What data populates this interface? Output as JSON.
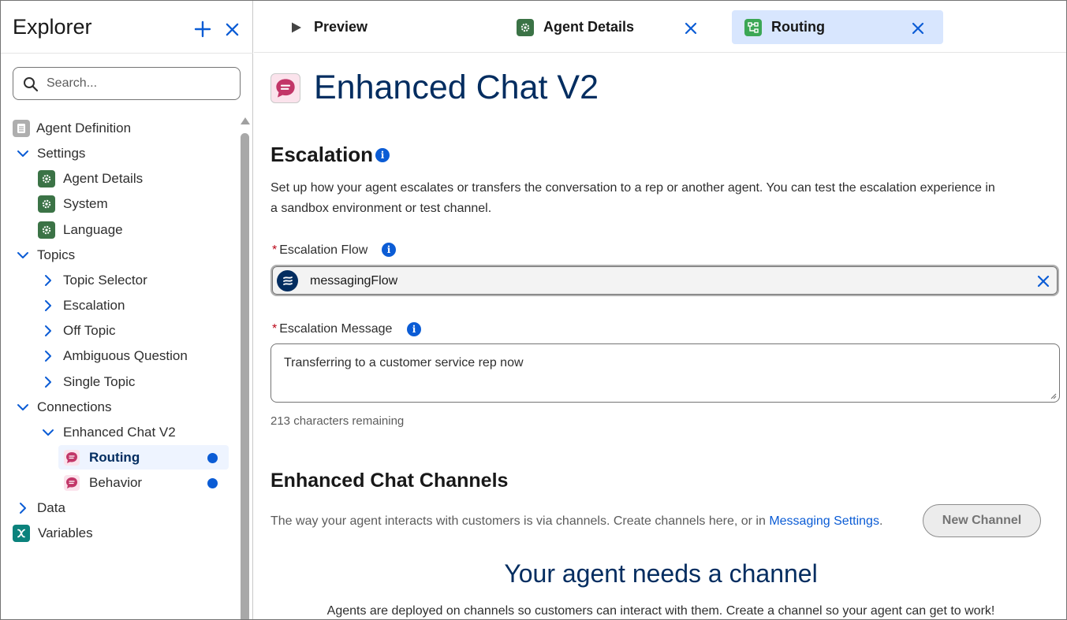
{
  "sidebar": {
    "title": "Explorer",
    "search_placeholder": "Search...",
    "tree": {
      "agent_definition": "Agent Definition",
      "settings": "Settings",
      "agent_details": "Agent Details",
      "system": "System",
      "language": "Language",
      "topics": "Topics",
      "topic_selector": "Topic Selector",
      "escalation": "Escalation",
      "off_topic": "Off Topic",
      "ambiguous_question": "Ambiguous Question",
      "single_topic": "Single Topic",
      "connections": "Connections",
      "enhanced_chat_v2": "Enhanced Chat V2",
      "routing": "Routing",
      "behavior": "Behavior",
      "data": "Data",
      "variables": "Variables"
    }
  },
  "tabs": {
    "preview": "Preview",
    "agent_details": "Agent Details",
    "routing": "Routing"
  },
  "main": {
    "title": "Enhanced Chat V2",
    "escalation": {
      "heading": "Escalation",
      "description_line1": "Set up how your agent escalates or transfers the conversation to a rep or another agent. You can test the escalation experience in",
      "description_line2": "a sandbox environment or test channel.",
      "flow_label": "Escalation Flow",
      "flow_value": "messagingFlow",
      "message_label": "Escalation Message",
      "message_value": "Transferring to a customer service rep now",
      "chars_remaining": "213 characters remaining"
    },
    "channels": {
      "heading": "Enhanced Chat Channels",
      "description": "The way your agent interacts with customers is via channels. Create channels here, or in ",
      "link": "Messaging Settings",
      "period": ".",
      "new_button": "New Channel",
      "empty_title": "Your agent needs a channel",
      "empty_desc": "Agents are deployed on channels so customers can interact with them. Create a channel so your agent can get to work!"
    }
  },
  "colors": {
    "brand_blue": "#0b5cd5",
    "title_navy": "#032d60",
    "selected_tab": "#d8e6fe",
    "gear_green": "#3b7346",
    "required_red": "#ba0517"
  }
}
